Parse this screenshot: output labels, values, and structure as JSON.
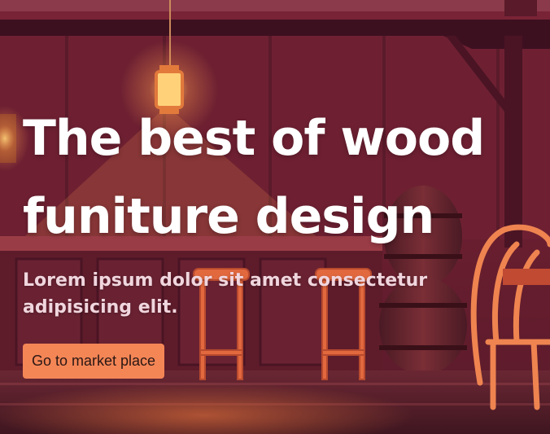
{
  "hero": {
    "headline_line1": "The best of wood",
    "headline_line2": "funiture design",
    "subtext": "Lorem ipsum dolor sit amet consectetur adipisicing elit.",
    "cta_label": "Go to market place"
  },
  "colors": {
    "button_bg": "#f48656",
    "button_text": "#2a1714",
    "headline": "#ffffff",
    "subtext": "#f0d6de",
    "background": "#6a1e2b"
  }
}
